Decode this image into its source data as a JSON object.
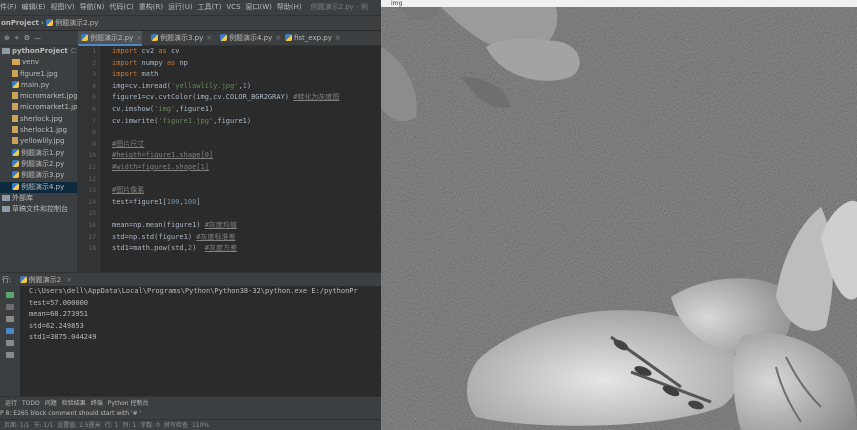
{
  "ide": {
    "menu": [
      "件(F)",
      "编辑(E)",
      "视图(V)",
      "导航(N)",
      "代码(C)",
      "重构(R)",
      "运行(U)",
      "工具(T)",
      "VCS",
      "窗口(W)",
      "帮助(H)"
    ],
    "window_title": "例题演示2.py - 例",
    "breadcrumb": {
      "project": "onProject",
      "separator": "›",
      "file": "例题演示2.py"
    },
    "tool_tabs": [
      "⊕",
      "÷",
      "⚙",
      "—"
    ],
    "editor_tabs": [
      {
        "label": "例题演示2.py",
        "active": true
      },
      {
        "label": "例题演示3.py",
        "active": false
      },
      {
        "label": "例题演示4.py",
        "active": false
      },
      {
        "label": "fist_exp.py",
        "active": false
      }
    ],
    "project_tree": [
      {
        "label": "pythonProject",
        "suffix": "C:\\p",
        "kind": "folder",
        "indent": 0,
        "bold": true
      },
      {
        "label": "venv",
        "kind": "folder",
        "indent": 1
      },
      {
        "label": "figure1.jpg",
        "kind": "file",
        "indent": 1
      },
      {
        "label": "main.py",
        "kind": "py",
        "indent": 1
      },
      {
        "label": "micromarket.jpg",
        "kind": "file",
        "indent": 1
      },
      {
        "label": "micromarket1.jp",
        "kind": "file",
        "indent": 1
      },
      {
        "label": "sherlock.jpg",
        "kind": "file",
        "indent": 1
      },
      {
        "label": "sherlock1.jpg",
        "kind": "file",
        "indent": 1
      },
      {
        "label": "yellowlily.jpg",
        "kind": "file",
        "indent": 1
      },
      {
        "label": "例题演示1.py",
        "kind": "py",
        "indent": 1
      },
      {
        "label": "例题演示2.py",
        "kind": "py",
        "indent": 1
      },
      {
        "label": "例题演示3.py",
        "kind": "py",
        "indent": 1
      },
      {
        "label": "例题演示4.py",
        "kind": "py",
        "indent": 1,
        "selected": true
      },
      {
        "label": "外部库",
        "kind": "lib",
        "indent": 0
      },
      {
        "label": "草稿文件和控制台",
        "kind": "scratch",
        "indent": 0
      }
    ],
    "line_numbers": [
      "1",
      "2",
      "3",
      "4",
      "5",
      "6",
      "7",
      "8",
      "9",
      "10",
      "11",
      "12",
      "13",
      "14",
      "15",
      "16",
      "17",
      "18"
    ],
    "code_lines": [
      "import cv2 as cv",
      "import numpy as np",
      "import math",
      "img=cv.imread('yellowlily.jpg',1)",
      "figure1=cv.cvtColor(img,cv.COLOR_BGR2GRAY) #转化为灰度图",
      "cv.imshow('img',figure1)",
      "cv.imwrite('figure1.jpg',figure1)",
      "",
      "#图片尺寸",
      "#heigth=figure1.shape[0]",
      "#width=figure1.shape[1]",
      "",
      "#图片像素",
      "test=figure1[100,100]",
      "",
      "mean=np.mean(figure1) #灰度均值",
      "std=np.std(figure1) #灰度标准差",
      "std1=math.pow(std,2)  #灰度方差"
    ],
    "run_tab": {
      "prefix": "行:",
      "label": "例题演示2",
      "close": "×"
    },
    "console_lines": [
      "C:\\Users\\dell\\AppData\\Local\\Programs\\Python\\Python38-32\\python.exe E:/pythonPr",
      "test=57.000000",
      "mean=68.273951",
      "std=62.249853",
      "std1=3875.044249"
    ],
    "bottom_tabs": [
      "运行",
      "TODO",
      "问题",
      "检验结果",
      "终端",
      "Python 控制台"
    ],
    "status_message": "P 8: E265 block comment should start with '# '",
    "status_items": [
      "页面: 1/1",
      "节: 1/1",
      "设置值: 2.5厘米",
      "行: 1",
      "列: 1",
      "字数: 0",
      "拼写检查",
      "110%"
    ]
  },
  "image_window": {
    "title": "img"
  }
}
